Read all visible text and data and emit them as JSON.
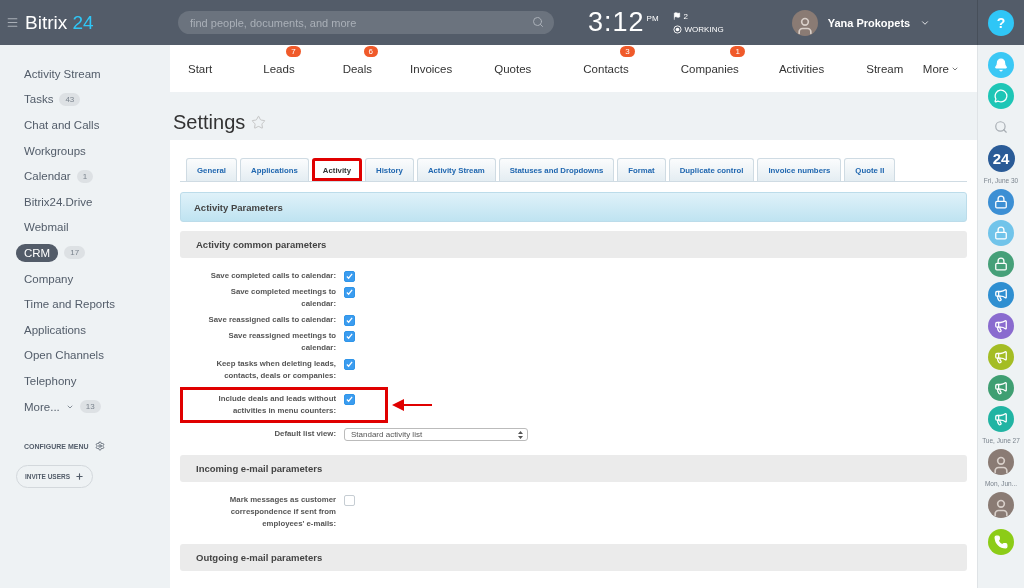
{
  "header": {
    "logo_main": "Bitrix",
    "logo_accent": "24",
    "search": {
      "placeholder": "find people, documents, and more"
    },
    "time": "3:12",
    "meridiem": "PM",
    "flags": "2",
    "status": "WORKING",
    "user": "Yana Prokopets",
    "help": "?"
  },
  "sidebar": {
    "items": [
      {
        "label": "Activity Stream",
        "selected": false
      },
      {
        "label": "Tasks",
        "count": "43",
        "selected": false
      },
      {
        "label": "Chat and Calls",
        "selected": false
      },
      {
        "label": "Workgroups",
        "selected": false
      },
      {
        "label": "Calendar",
        "count": "1",
        "selected": false
      },
      {
        "label": "Bitrix24.Drive",
        "selected": false
      },
      {
        "label": "Webmail",
        "selected": false
      },
      {
        "label": "CRM",
        "count": "17",
        "selected": true
      },
      {
        "label": "Company",
        "selected": false
      },
      {
        "label": "Time and Reports",
        "selected": false
      },
      {
        "label": "Applications",
        "selected": false
      },
      {
        "label": "Open Channels",
        "selected": false
      },
      {
        "label": "Telephony",
        "selected": false
      },
      {
        "label": "More...",
        "count": "13",
        "selected": false,
        "dropdown": true
      }
    ],
    "configure": "CONFIGURE MENU",
    "invite": "INVITE USERS"
  },
  "nav": {
    "items": [
      {
        "label": "Start"
      },
      {
        "label": "Leads",
        "badge": "7"
      },
      {
        "label": "Deals",
        "badge": "6"
      },
      {
        "label": "Invoices"
      },
      {
        "label": "Quotes"
      },
      {
        "label": "Contacts",
        "badge": "3"
      },
      {
        "label": "Companies",
        "badge": "1"
      },
      {
        "label": "Activities"
      },
      {
        "label": "Stream"
      }
    ],
    "more": "More"
  },
  "page": {
    "title": "Settings"
  },
  "tabs": [
    {
      "label": "General",
      "selected": false,
      "highlighted": false
    },
    {
      "label": "Applications",
      "selected": false,
      "highlighted": false
    },
    {
      "label": "Activity",
      "selected": true,
      "highlighted": true
    },
    {
      "label": "History",
      "selected": false,
      "highlighted": false
    },
    {
      "label": "Activity Stream",
      "selected": false,
      "highlighted": false
    },
    {
      "label": "Statuses and Dropdowns",
      "selected": false,
      "highlighted": false
    },
    {
      "label": "Format",
      "selected": false,
      "highlighted": false
    },
    {
      "label": "Duplicate control",
      "selected": false,
      "highlighted": false
    },
    {
      "label": "Invoice numbers",
      "selected": false,
      "highlighted": false
    },
    {
      "label": "Quote II",
      "selected": false,
      "highlighted": false
    }
  ],
  "panel_title": "Activity Parameters",
  "sections": [
    {
      "title": "Activity common parameters",
      "rows": [
        {
          "kind": "checkbox",
          "label": "Save completed calls to calendar:",
          "checked": true,
          "highlighted": false
        },
        {
          "kind": "checkbox",
          "label": "Save completed meetings to calendar:",
          "checked": true,
          "highlighted": false
        },
        {
          "kind": "checkbox",
          "label": "Save reassigned calls to calendar:",
          "checked": true,
          "highlighted": false
        },
        {
          "kind": "checkbox",
          "label": "Save reassigned meetings to calendar:",
          "checked": true,
          "highlighted": false
        },
        {
          "kind": "checkbox",
          "label": "Keep tasks when deleting leads, contacts, deals or companies:",
          "checked": true,
          "highlighted": false
        },
        {
          "kind": "checkbox",
          "label": "Include deals and leads without activities in menu counters:",
          "checked": true,
          "highlighted": true
        },
        {
          "kind": "select",
          "label": "Default list view:",
          "value": "Standard activity list",
          "highlighted": false
        }
      ]
    },
    {
      "title": "Incoming e-mail parameters",
      "rows": [
        {
          "kind": "checkbox",
          "label": "Mark messages as customer correspondence if sent from employees' e-mails:",
          "checked": false,
          "highlighted": false
        }
      ]
    },
    {
      "title": "Outgoing e-mail parameters"
    }
  ],
  "right_bar": [
    {
      "kind": "bell",
      "color": "#3bc8f5"
    },
    {
      "kind": "chat",
      "color": "#1ec6b6"
    },
    {
      "kind": "search"
    },
    {
      "kind": "counter",
      "color": "#2a5b97",
      "text": "24"
    },
    {
      "kind": "date",
      "text": "Fri, June 30"
    },
    {
      "kind": "lock",
      "color": "#3c8fd4"
    },
    {
      "kind": "lock",
      "color": "#71c4ea"
    },
    {
      "kind": "lock",
      "color": "#46a079"
    },
    {
      "kind": "megaphone",
      "color": "#2f8fd1"
    },
    {
      "kind": "megaphone",
      "color": "#8a6bcf"
    },
    {
      "kind": "megaphone",
      "color": "#a4bd24"
    },
    {
      "kind": "megaphone",
      "color": "#3f9f72"
    },
    {
      "kind": "megaphone",
      "color": "#21b4a3"
    },
    {
      "kind": "date",
      "text": "Tue, June 27"
    },
    {
      "kind": "avatar"
    },
    {
      "kind": "date",
      "text": "Mon, Jun..."
    },
    {
      "kind": "avatar"
    },
    {
      "kind": "phone",
      "color": "#8ccc17"
    }
  ]
}
